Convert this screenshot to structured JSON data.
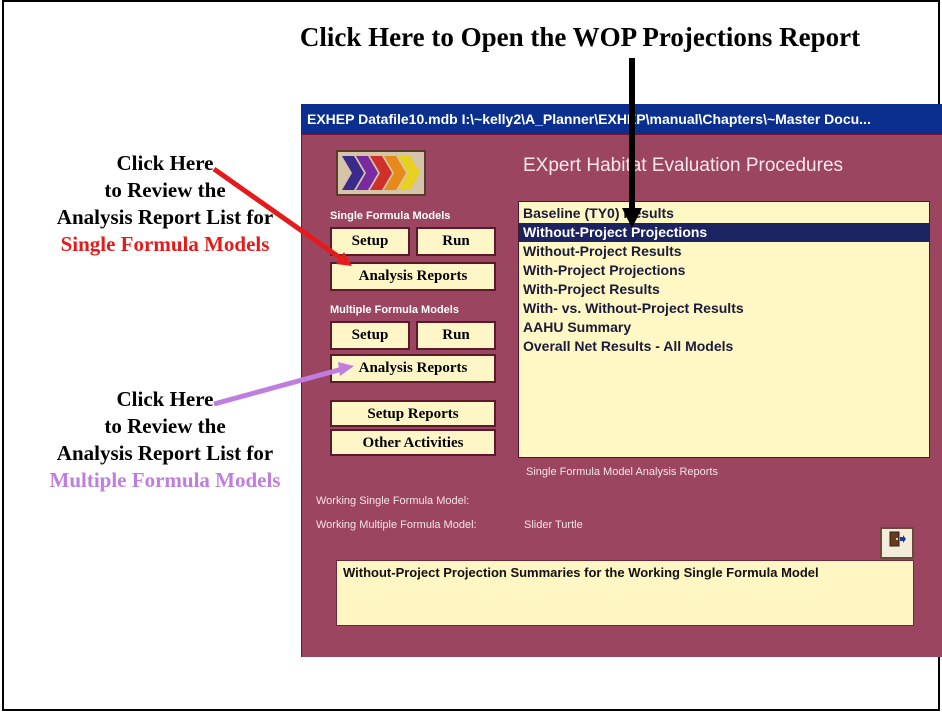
{
  "callouts": {
    "top": "Click Here to Open the WOP Projections Report",
    "left1": [
      "Click Here",
      "to Review the",
      "Analysis Report List for",
      "Single Formula Models"
    ],
    "left2": [
      "Click Here",
      "to Review the",
      "Analysis Report List for",
      "Multiple Formula Models"
    ]
  },
  "window": {
    "title": "EXHEP   Datafile10.mdb   I:\\~kelly2\\A_Planner\\EXHEP\\manual\\Chapters\\~Master Docu...",
    "app_title": "EXpert Habitat Evaluation Procedures"
  },
  "single": {
    "label": "Single Formula Models",
    "setup": "Setup",
    "run": "Run",
    "analysis": "Analysis Reports"
  },
  "multiple": {
    "label": "Multiple Formula Models",
    "setup": "Setup",
    "run": "Run",
    "analysis": "Analysis Reports"
  },
  "other": {
    "setup_reports": "Setup Reports",
    "other_activities": "Other Activities"
  },
  "list": {
    "items": [
      "Baseline (TY0) Results",
      "Without-Project Projections",
      "Without-Project Results",
      "With-Project Projections",
      "With-Project Results",
      "With- vs. Without-Project Results",
      "AAHU Summary",
      "Overall Net Results - All Models"
    ],
    "selected_index": 1,
    "caption": "Single Formula Model Analysis Reports"
  },
  "working": {
    "single_label": "Working Single Formula Model:",
    "single_value": "",
    "multiple_label": "Working Multiple Formula Model:",
    "multiple_value": "Slider Turtle"
  },
  "exit_icon": "exit-door-icon",
  "description": "Without-Project Projection Summaries for the Working Single Formula Model",
  "colors": {
    "window_bg": "#9b4560",
    "titlebar": "#0a2f8e",
    "list_bg": "#fff8c4",
    "selection": "#1b2360",
    "red_arrow": "#e31b1b",
    "violet_arrow": "#c07de0"
  }
}
